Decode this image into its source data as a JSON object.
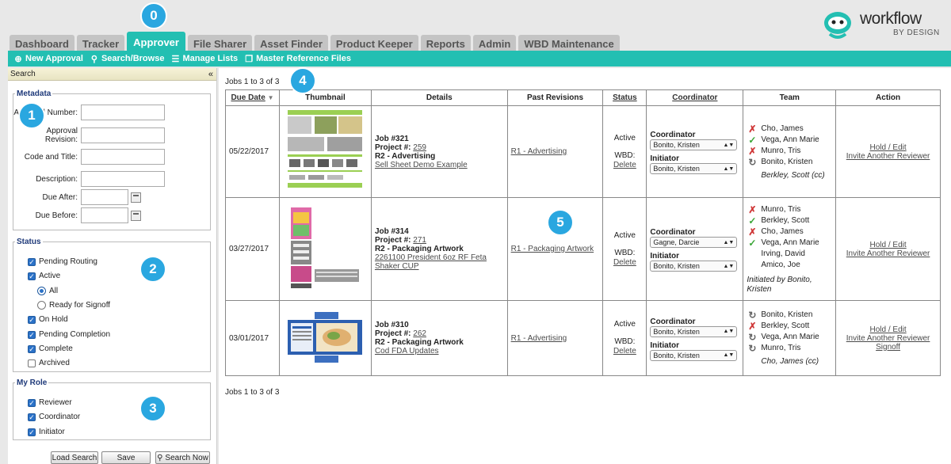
{
  "callouts": [
    "0",
    "1",
    "2",
    "3",
    "4",
    "5"
  ],
  "tabs": [
    {
      "label": "Dashboard"
    },
    {
      "label": "Tracker"
    },
    {
      "label": "Approver"
    },
    {
      "label": "File Sharer"
    },
    {
      "label": "Asset Finder"
    },
    {
      "label": "Product Keeper"
    },
    {
      "label": "Reports"
    },
    {
      "label": "Admin"
    },
    {
      "label": "WBD Maintenance"
    }
  ],
  "toolbar": {
    "new_approval": "New Approval",
    "search_browse": "Search/Browse",
    "manage_lists": "Manage Lists",
    "master_reference": "Master Reference Files"
  },
  "logo": {
    "name": "workflow",
    "sub": "BY DESIGN"
  },
  "sidebar": {
    "title": "Search",
    "collapse": "«",
    "metadata": {
      "legend": "Metadata",
      "fields": [
        {
          "label": "Approval Number:",
          "value": ""
        },
        {
          "label": "Approval Revision:",
          "value": ""
        },
        {
          "label": "Code and Title:",
          "value": ""
        },
        {
          "label": "Description:",
          "value": ""
        },
        {
          "label": "Due After:",
          "value": ""
        },
        {
          "label": "Due Before:",
          "value": ""
        }
      ]
    },
    "status": {
      "legend": "Status",
      "pending_routing": "Pending Routing",
      "active": "Active",
      "all": "All",
      "ready_for_signoff": "Ready for Signoff",
      "on_hold": "On Hold",
      "pending_completion": "Pending Completion",
      "complete": "Complete",
      "archived": "Archived"
    },
    "my_role": {
      "legend": "My Role",
      "reviewer": "Reviewer",
      "coordinator": "Coordinator",
      "initiator": "Initiator"
    },
    "buttons": {
      "load": "Load Search",
      "save": "Save",
      "search_now": "Search Now"
    }
  },
  "main": {
    "jobs_count_top": "Jobs 1 to 3 of 3",
    "jobs_count_bottom": "Jobs 1 to 3 of 3",
    "headers": {
      "due_date": "Due Date",
      "thumbnail": "Thumbnail",
      "details": "Details",
      "past_revisions": "Past Revisions",
      "status": "Status",
      "coordinator": "Coordinator",
      "team": "Team",
      "action": "Action"
    },
    "labels": {
      "coordinator": "Coordinator",
      "initiator": "Initiator",
      "wbd": "WBD:",
      "delete": "Delete",
      "project": "Project #:"
    },
    "rows": [
      {
        "due": "05/22/2017",
        "job": "Job #321",
        "project": "259",
        "revision": "R2 - Advertising",
        "title": "Sell Sheet Demo Example",
        "past": "R1 - Advertising",
        "status": "Active",
        "coordinator": "Bonito, Kristen",
        "initiator": "Bonito, Kristen",
        "team": [
          {
            "icon": "x",
            "name": "Cho, James"
          },
          {
            "icon": "check",
            "name": "Vega, Ann Marie"
          },
          {
            "icon": "xcheck",
            "name": "Munro, Tris"
          },
          {
            "icon": "refresh",
            "name": "Bonito, Kristen"
          }
        ],
        "team_note": "Berkley, Scott (cc)",
        "actions": [
          "Hold / Edit",
          "Invite Another Reviewer"
        ]
      },
      {
        "due": "03/27/2017",
        "job": "Job #314",
        "project": "271",
        "revision": "R2 - Packaging Artwork",
        "title": "2261100 President 6oz RF Feta Shaker CUP",
        "past": "R1 - Packaging Artwork",
        "status": "Active",
        "coordinator": "Gagne, Darcie",
        "initiator": "Bonito, Kristen",
        "team": [
          {
            "icon": "x",
            "name": "Munro, Tris"
          },
          {
            "icon": "check",
            "name": "Berkley, Scott"
          },
          {
            "icon": "xcheck",
            "name": "Cho, James"
          },
          {
            "icon": "check",
            "name": "Vega, Ann Marie"
          },
          {
            "icon": "blank",
            "name": "Irving, David"
          },
          {
            "icon": "blank",
            "name": "Amico, Joe"
          }
        ],
        "team_note": "Initiated by Bonito, Kristen",
        "actions": [
          "Hold / Edit",
          "Invite Another Reviewer"
        ]
      },
      {
        "due": "03/01/2017",
        "job": "Job #310",
        "project": "262",
        "revision": "R2 - Packaging Artwork",
        "title": "Cod FDA Updates",
        "past": "R1 - Advertising",
        "status": "Active",
        "coordinator": "Bonito, Kristen",
        "initiator": "Bonito, Kristen",
        "team": [
          {
            "icon": "refresh",
            "name": "Bonito, Kristen"
          },
          {
            "icon": "xcheck",
            "name": "Berkley, Scott"
          },
          {
            "icon": "refresh",
            "name": "Vega, Ann Marie"
          },
          {
            "icon": "refresh",
            "name": "Munro, Tris"
          }
        ],
        "team_note": "Cho, James (cc)",
        "actions": [
          "Hold / Edit",
          "Invite Another Reviewer",
          "Signoff"
        ]
      }
    ]
  }
}
